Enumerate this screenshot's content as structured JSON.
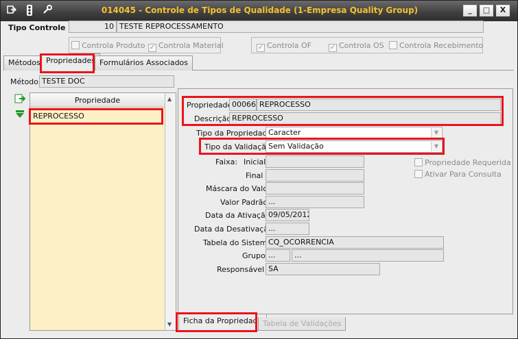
{
  "window": {
    "title": "014045 - Controle de Tipos de Qualidade (1-Empresa Quality Group)",
    "minimize": "_",
    "maximize": "□",
    "close": "X"
  },
  "header": {
    "tipo_controle_label": "Tipo Controle",
    "tipo_controle_code": "10",
    "tipo_controle_name": "TESTE REPROCESSAMENTO",
    "checks": [
      {
        "label": "Controla Produto",
        "checked": false
      },
      {
        "label": "Controla Material",
        "checked": true
      },
      {
        "label": "Controla OF",
        "checked": true
      },
      {
        "label": "Controla OS",
        "checked": true
      },
      {
        "label": "Controla Recebimento",
        "checked": false
      }
    ]
  },
  "tabs": {
    "metodos": "Métodos",
    "propriedades": "Propriedades",
    "formularios": "Formulários Associados"
  },
  "metodo": {
    "label": "Método",
    "value": "TESTE DOC"
  },
  "list": {
    "header": "Propriedade",
    "items": [
      "REPROCESSO"
    ]
  },
  "form": {
    "propriedade_label": "Propriedade",
    "propriedade_code": "00066",
    "propriedade_name": "REPROCESSO",
    "descricao_label": "Descrição",
    "descricao_value": "REPROCESSO",
    "tipo_propriedade_label": "Tipo da Propriedade",
    "tipo_propriedade_value": "Caracter",
    "tipo_validacao_label": "Tipo da Validação",
    "tipo_validacao_value": "Sem Validação",
    "faixa_label": "Faixa:",
    "inicial_label": "Inicial",
    "final_label": "Final",
    "mascara_label": "Máscara do Valor",
    "valor_padrao_label": "Valor Padrão",
    "valor_padrao_value": "...",
    "data_ativacao_label": "Data da Ativação",
    "data_ativacao_value": "09/05/2012",
    "data_desativacao_label": "Data da Desativação",
    "data_desativacao_value": "...",
    "tabela_label": "Tabela do Sistema",
    "tabela_value": "CQ_OCORRENCIA",
    "grupo_label": "Grupo",
    "grupo_value1": "...",
    "grupo_value2": "...",
    "responsavel_label": "Responsável",
    "responsavel_value": "SA",
    "propriedade_requerida": "Propriedade Requerida",
    "ativar_consulta": "Ativar Para Consulta"
  },
  "bottom_tabs": {
    "ficha": "Ficha da Propriedade",
    "tabela": "Tabela de Validações"
  },
  "colors": {
    "highlight": "#e8141b",
    "title_text": "#f5c030",
    "list_bg": "#fdf0c6"
  }
}
